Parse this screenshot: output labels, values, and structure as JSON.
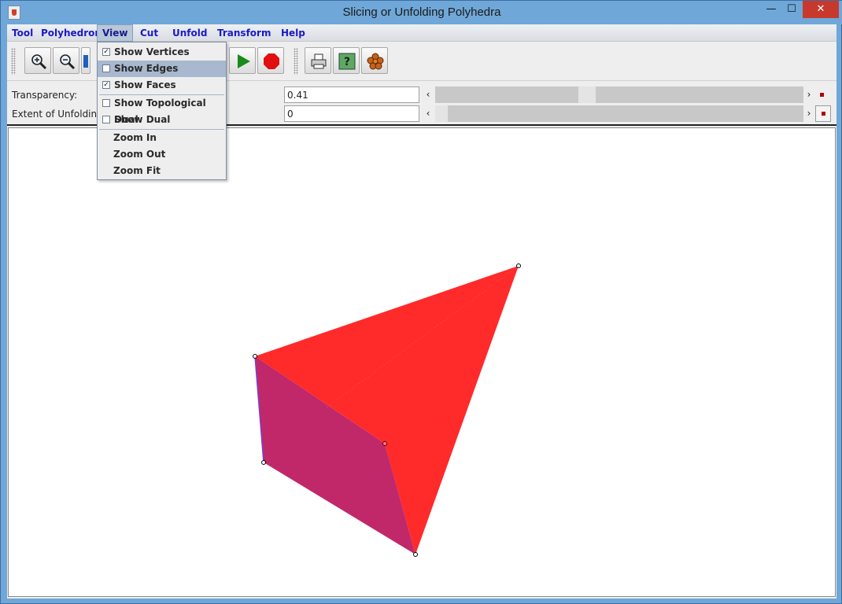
{
  "window": {
    "title": "Slicing or Unfolding Polyhedra"
  },
  "menubar": {
    "items": [
      {
        "label": "Tool"
      },
      {
        "label": "Polyhedron"
      },
      {
        "label": "View"
      },
      {
        "label": "Cut"
      },
      {
        "label": "Unfold"
      },
      {
        "label": "Transform"
      },
      {
        "label": "Help"
      }
    ],
    "active": "View"
  },
  "view_menu": {
    "items": [
      {
        "label": "Show Vertices",
        "checkbox": true,
        "checked": true
      },
      {
        "label": "Show Edges",
        "checkbox": true,
        "checked": false,
        "highlighted": true
      },
      {
        "label": "Show Faces",
        "checkbox": true,
        "checked": true
      },
      {
        "label": "Show Topological Dual",
        "checkbox": true,
        "checked": false
      },
      {
        "label": "Show Dual",
        "checkbox": true,
        "checked": false
      },
      {
        "label": "Zoom In"
      },
      {
        "label": "Zoom Out"
      },
      {
        "label": "Zoom Fit"
      }
    ]
  },
  "toolbar": {
    "buttons": [
      "zoom-in-icon",
      "zoom-out-icon",
      "fit-icon",
      "play-icon",
      "stop-icon",
      "print-icon",
      "help-icon",
      "polyhedron-icon"
    ],
    "colors": {
      "play": "#1a8a1a",
      "stop": "#e01010"
    }
  },
  "controls": {
    "transparency_label": "Transparency:",
    "transparency_value": "0.41",
    "unfolding_label": "Extent of Unfolding:",
    "unfolding_value": "0"
  },
  "scene": {
    "colors": {
      "front_face": "#ff2a2a",
      "side_face": "#c0286a",
      "edge_highlight": "#7a3fd0"
    }
  }
}
